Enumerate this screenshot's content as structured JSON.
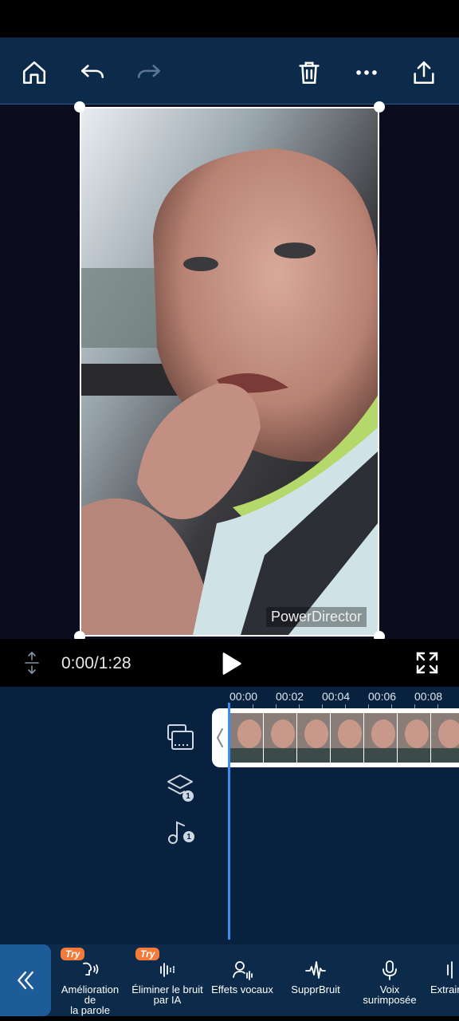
{
  "toolbar": {
    "icons": [
      "home-icon",
      "undo-icon",
      "redo-icon",
      "trash-icon",
      "more-icon",
      "export-icon"
    ]
  },
  "preview": {
    "watermark": "PowerDirector"
  },
  "playback": {
    "time": "0:00/1:28"
  },
  "timeline": {
    "ruler": [
      "00:00",
      "00:02",
      "00:04",
      "00:06",
      "00:08"
    ],
    "layer_badge": "1",
    "audio_badge": "1"
  },
  "tools": [
    {
      "label": "Amélioration de\nla parole",
      "try": "Try"
    },
    {
      "label": "Éliminer le bruit\npar IA",
      "try": "Try"
    },
    {
      "label": "Effets vocaux",
      "try": ""
    },
    {
      "label": "SupprBruit",
      "try": ""
    },
    {
      "label": "Voix\nsurimposée",
      "try": ""
    },
    {
      "label": "Extrair",
      "try": ""
    }
  ],
  "colors": {
    "toolbar_bg": "#0c2a4a",
    "timeline_bg": "#08213f",
    "playhead": "#3b8df2",
    "try_badge": "#f47a3a"
  }
}
